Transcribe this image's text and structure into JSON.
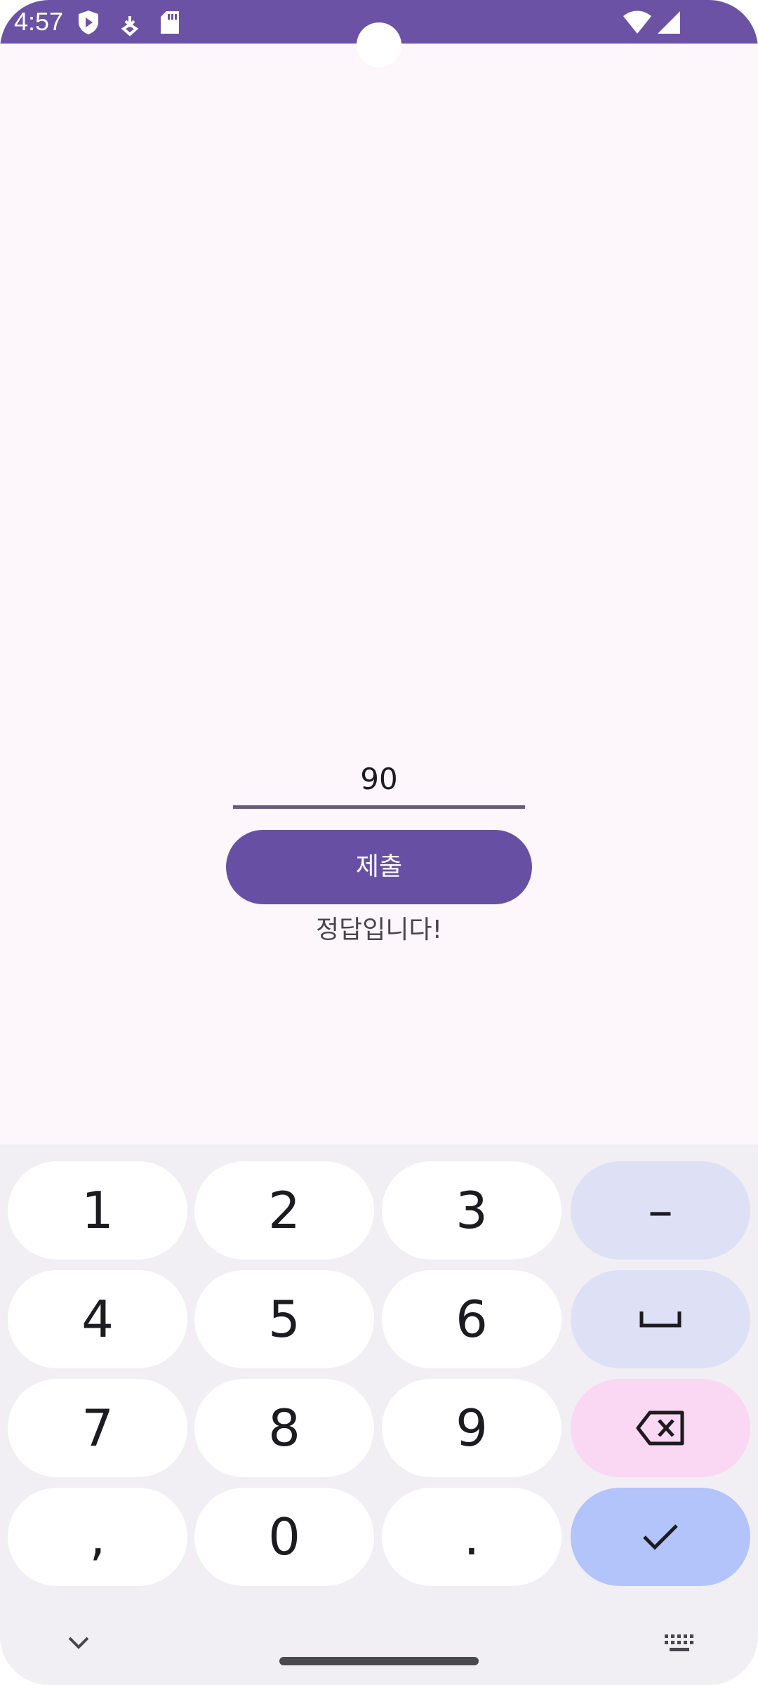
{
  "status_bar": {
    "time": "4:57",
    "icons_left": [
      "shield-play-icon",
      "download-icon",
      "sd-card-icon"
    ],
    "icons_right": [
      "wifi-icon",
      "cell-signal-icon"
    ],
    "color": "#6b52a5"
  },
  "content": {
    "answer_value": "90",
    "submit_label": "제출",
    "result_text": "정답입니다!",
    "accent_color": "#6750a4"
  },
  "keyboard": {
    "rows": [
      [
        "1",
        "2",
        "3",
        "–"
      ],
      [
        "4",
        "5",
        "6",
        "space"
      ],
      [
        "7",
        "8",
        "9",
        "backspace"
      ],
      [
        ",",
        "0",
        ".",
        "enter"
      ]
    ],
    "key_color": "#ffffff",
    "function_key_color": "#dee0f5",
    "delete_key_color": "#fad7f2",
    "enter_key_color": "#b2c4fa",
    "bottom_left_icon": "chevron-down-icon",
    "bottom_right_icon": "keyboard-icon"
  }
}
